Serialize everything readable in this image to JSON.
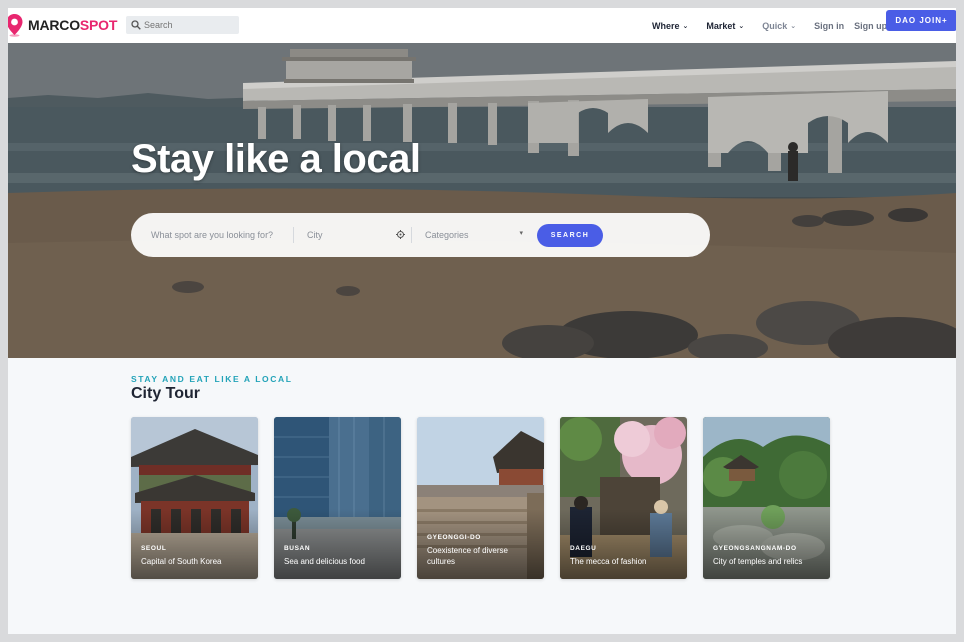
{
  "brand": {
    "name_part1": "MARCO",
    "name_part2": "SPOT",
    "accent_color": "#e8266f"
  },
  "nav": {
    "search_placeholder": "Search",
    "links": [
      {
        "label": "Where",
        "has_dropdown": true
      },
      {
        "label": "Market",
        "has_dropdown": true
      },
      {
        "label": "Quick",
        "has_dropdown": true
      }
    ],
    "signin": "Sign in",
    "signup": "Sign up",
    "join": "DAO JOIN+"
  },
  "hero": {
    "title": "Stay like a local",
    "what_placeholder": "What spot are you looking for?",
    "city_placeholder": "City",
    "categories_placeholder": "Categories",
    "search_button": "SEARCH"
  },
  "section": {
    "eyebrow": "STAY AND EAT LIKE A LOCAL",
    "title": "City Tour"
  },
  "cards": [
    {
      "city": "SEOUL",
      "desc": "Capital of South Korea"
    },
    {
      "city": "BUSAN",
      "desc": "Sea and delicious food"
    },
    {
      "city": "GYEONGGI-DO",
      "desc": "Coexistence of diverse cultures"
    },
    {
      "city": "DAEGU",
      "desc": "The mecca of fashion"
    },
    {
      "city": "GYEONGSANGNAM-DO",
      "desc": "City of temples and relics"
    }
  ],
  "colors": {
    "primary": "#4a5de6",
    "eyebrow": "#23a3b8"
  }
}
